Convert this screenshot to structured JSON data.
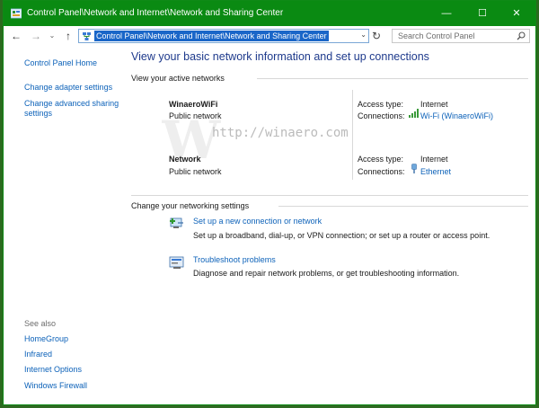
{
  "window": {
    "title": "Control Panel\\Network and Internet\\Network and Sharing Center",
    "controls": {
      "minimize": "—",
      "maximize": "☐",
      "close": "✕"
    }
  },
  "address": {
    "path": "Control Panel\\Network and Internet\\Network and Sharing Center",
    "search_placeholder": "Search Control Panel"
  },
  "sidebar": {
    "home": "Control Panel Home",
    "items": [
      "Change adapter settings",
      "Change advanced sharing settings"
    ],
    "see_also_label": "See also",
    "see_also": [
      "HomeGroup",
      "Infrared",
      "Internet Options",
      "Windows Firewall"
    ]
  },
  "main": {
    "title": "View your basic network information and set up connections",
    "active_networks_heading": "View your active networks",
    "networks": [
      {
        "name": "WinaeroWiFi",
        "type": "Public network",
        "access_label": "Access type:",
        "access": "Internet",
        "conn_label": "Connections:",
        "connection": "Wi-Fi (WinaeroWiFi)"
      },
      {
        "name": "Network",
        "type": "Public network",
        "access_label": "Access type:",
        "access": "Internet",
        "conn_label": "Connections:",
        "connection": "Ethernet"
      }
    ],
    "settings_heading": "Change your networking settings",
    "tasks": [
      {
        "link": "Set up a new connection or network",
        "desc": "Set up a broadband, dial-up, or VPN connection; or set up a router or access point."
      },
      {
        "link": "Troubleshoot problems",
        "desc": "Diagnose and repair network problems, or get troubleshooting information."
      }
    ]
  },
  "watermark": {
    "text": "http://winaero.com"
  },
  "colors": {
    "titlebar": "#0a8a12",
    "link": "#0d62b9",
    "title_text": "#1e3a8c",
    "selection": "#1a66c8"
  }
}
